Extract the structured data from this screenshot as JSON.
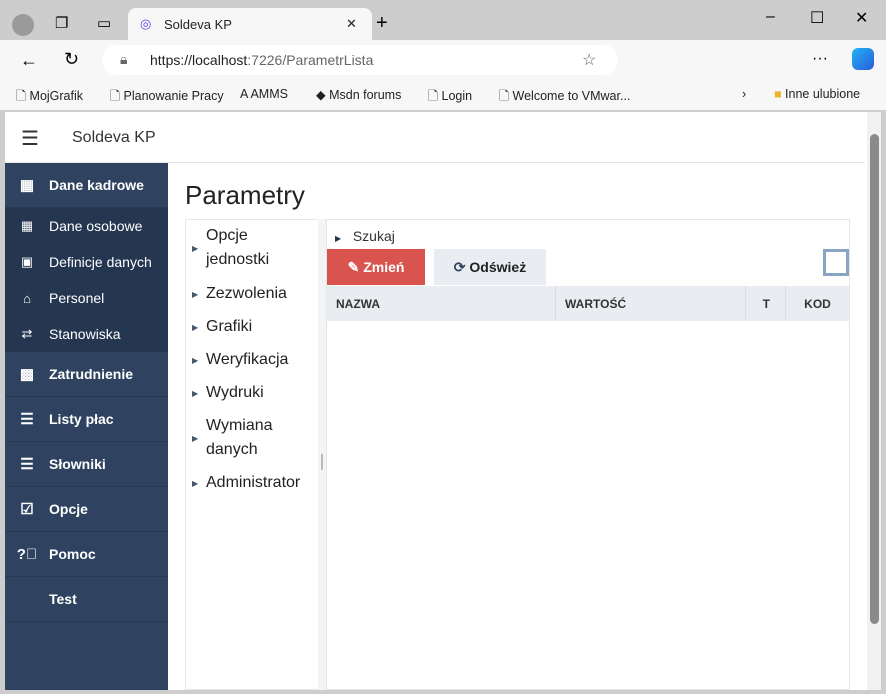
{
  "browser": {
    "tab_title": "Soldeva KP",
    "url_host": "https://localhost",
    "url_rest": ":7226/ParametrLista",
    "bookmarks": [
      "MojGrafik",
      "Planowanie Pracy",
      "AMMS",
      "Msdn forums",
      "Login",
      "Welcome to VMwar...",
      "Inne ulubione"
    ]
  },
  "app": {
    "title": "Soldeva KP"
  },
  "sidebar": {
    "section": "Dane kadrowe",
    "sub": [
      "Dane osobowe",
      "Definicje danych",
      "Personel",
      "Stanowiska"
    ],
    "items": [
      "Zatrudnienie",
      "Listy płac",
      "Słowniki",
      "Opcje",
      "Pomoc",
      "Test"
    ]
  },
  "main": {
    "title": "Parametry",
    "tree": [
      "Opcje jednostki",
      "Zezwolenia",
      "Grafiki",
      "Weryfikacja",
      "Wydruki",
      "Wymiana danych",
      "Administrator"
    ],
    "search": "Szukaj",
    "edit": "Zmień",
    "refresh": "Odśwież",
    "columns": [
      "NAZWA",
      "WARTOŚĆ",
      "T",
      "KOD"
    ]
  },
  "colors": {
    "sidebar": "#2f4360",
    "accent": "#d9534f"
  }
}
